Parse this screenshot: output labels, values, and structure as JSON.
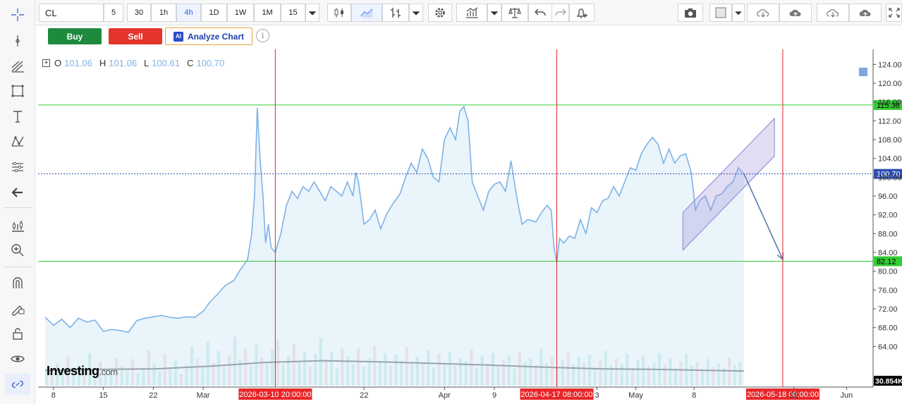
{
  "toolbar": {
    "symbol": "CL",
    "timeframes": [
      {
        "label": "5",
        "active": false
      },
      {
        "label": "30",
        "active": false
      },
      {
        "label": "1h",
        "active": false
      },
      {
        "label": "4h",
        "active": true
      },
      {
        "label": "1D",
        "active": false
      },
      {
        "label": "1W",
        "active": false
      },
      {
        "label": "1M",
        "active": false
      },
      {
        "label": "15",
        "active": false
      }
    ],
    "icons": [
      "candles-icon",
      "line-chart-icon",
      "bars-icon",
      "dropdown-icon",
      "settings-icon",
      "indicators-icon",
      "dropdown-icon",
      "compare-icon",
      "undo-icon",
      "redo-icon",
      "add-alert-icon",
      "camera-icon",
      "color-swatch-icon",
      "dropdown-icon",
      "cloud-download-icon",
      "cloud-upload-icon",
      "cloud-download-icon",
      "cloud-upload-icon",
      "fullscreen-icon"
    ]
  },
  "trade": {
    "buy_label": "Buy",
    "sell_label": "Sell",
    "analyze_label": "Analyze Chart",
    "ai_badge": "AI",
    "info_glyph": "i"
  },
  "legend": {
    "toggle_glyph": "+",
    "o_label": "O",
    "o_value": "101.06",
    "h_label": "H",
    "h_value": "101.06",
    "l_label": "L",
    "l_value": "100.61",
    "c_label": "C",
    "c_value": "100.70"
  },
  "logo": {
    "main": "Investing",
    "suffix": ".com"
  },
  "colors": {
    "line": "#7fb2e5",
    "area": "#e2f0fa",
    "hline": "#33cc33",
    "vline": "#e8262a",
    "current_price": "#2b4fb0",
    "vol_up": "#7fd6c0",
    "vol_down": "#f0a6b0",
    "channel": "#9a8fd6"
  },
  "chart_data": {
    "type": "area",
    "symbol": "CL",
    "interval": "4h",
    "ylim": [
      60,
      126
    ],
    "y_ticks": [
      "124.00",
      "120.00",
      "116.00",
      "112.00",
      "108.00",
      "104.00",
      "100.00",
      "96.00",
      "92.00",
      "88.00",
      "84.00",
      "80.00",
      "76.00",
      "72.00",
      "68.00",
      "64.00"
    ],
    "y_tick_values": [
      124,
      120,
      116,
      112,
      108,
      104,
      100,
      96,
      92,
      88,
      84,
      80,
      76,
      72,
      68,
      64
    ],
    "x_ticks": [
      {
        "label": "8",
        "idx": 0.3
      },
      {
        "label": "15",
        "idx": 2.1
      },
      {
        "label": "22",
        "idx": 3.9
      },
      {
        "label": "Mar",
        "idx": 5.7
      },
      {
        "label": "22",
        "idx": 11.5
      },
      {
        "label": "Apr",
        "idx": 14.4
      },
      {
        "label": "9",
        "idx": 16.2
      },
      {
        "label": "3",
        "idx": 19.9
      },
      {
        "label": "May",
        "idx": 21.3
      },
      {
        "label": "8",
        "idx": 23.4
      },
      {
        "label": "22",
        "idx": 27.0
      },
      {
        "label": "Jun",
        "idx": 28.9
      }
    ],
    "x_range": [
      0,
      29.5
    ],
    "price_series": [
      [
        0,
        70.2
      ],
      [
        0.3,
        68.5
      ],
      [
        0.6,
        69.8
      ],
      [
        0.9,
        68.0
      ],
      [
        1.2,
        70.0
      ],
      [
        1.5,
        69.2
      ],
      [
        1.8,
        69.6
      ],
      [
        2.1,
        67.2
      ],
      [
        2.4,
        67.6
      ],
      [
        2.7,
        67.4
      ],
      [
        3.0,
        67.0
      ],
      [
        3.3,
        69.5
      ],
      [
        3.6,
        70.0
      ],
      [
        3.9,
        70.3
      ],
      [
        4.2,
        70.6
      ],
      [
        4.5,
        70.2
      ],
      [
        4.8,
        70.0
      ],
      [
        5.1,
        70.3
      ],
      [
        5.4,
        70.2
      ],
      [
        5.7,
        71.5
      ],
      [
        5.95,
        73.5
      ],
      [
        6.2,
        75.0
      ],
      [
        6.5,
        77.0
      ],
      [
        6.8,
        78.0
      ],
      [
        7.0,
        80.0
      ],
      [
        7.3,
        82.5
      ],
      [
        7.45,
        88.0
      ],
      [
        7.55,
        96.0
      ],
      [
        7.65,
        114.8
      ],
      [
        7.75,
        104.0
      ],
      [
        7.85,
        96.5
      ],
      [
        7.95,
        86.0
      ],
      [
        8.05,
        90.0
      ],
      [
        8.15,
        85.0
      ],
      [
        8.3,
        84.0
      ],
      [
        8.5,
        88.0
      ],
      [
        8.7,
        94.0
      ],
      [
        8.9,
        97.0
      ],
      [
        9.1,
        95.5
      ],
      [
        9.3,
        98.0
      ],
      [
        9.5,
        97.0
      ],
      [
        9.7,
        99.0
      ],
      [
        9.9,
        97.0
      ],
      [
        10.1,
        95.0
      ],
      [
        10.3,
        98.0
      ],
      [
        10.5,
        97.0
      ],
      [
        10.7,
        96.0
      ],
      [
        10.9,
        99.0
      ],
      [
        11.1,
        96.0
      ],
      [
        11.2,
        101.0
      ],
      [
        11.3,
        99.0
      ],
      [
        11.5,
        90.0
      ],
      [
        11.7,
        91.0
      ],
      [
        11.9,
        93.0
      ],
      [
        12.1,
        89.0
      ],
      [
        12.3,
        92.0
      ],
      [
        12.5,
        94.0
      ],
      [
        12.8,
        96.5
      ],
      [
        13.0,
        100.0
      ],
      [
        13.2,
        103.0
      ],
      [
        13.4,
        101.0
      ],
      [
        13.6,
        106.0
      ],
      [
        13.8,
        104.0
      ],
      [
        14.0,
        100.0
      ],
      [
        14.2,
        99.0
      ],
      [
        14.4,
        108.0
      ],
      [
        14.6,
        110.5
      ],
      [
        14.8,
        108.0
      ],
      [
        14.95,
        114.0
      ],
      [
        15.1,
        115.0
      ],
      [
        15.25,
        112.0
      ],
      [
        15.4,
        99.0
      ],
      [
        15.6,
        96.0
      ],
      [
        15.8,
        93.0
      ],
      [
        16.0,
        97.0
      ],
      [
        16.2,
        98.5
      ],
      [
        16.4,
        99.0
      ],
      [
        16.6,
        97.0
      ],
      [
        16.8,
        103.5
      ],
      [
        17.0,
        96.0
      ],
      [
        17.2,
        90.0
      ],
      [
        17.4,
        91.0
      ],
      [
        17.7,
        90.5
      ],
      [
        17.9,
        92.5
      ],
      [
        18.1,
        94.0
      ],
      [
        18.25,
        93.0
      ],
      [
        18.35,
        85.0
      ],
      [
        18.45,
        81.8
      ],
      [
        18.55,
        87.0
      ],
      [
        18.7,
        86.0
      ],
      [
        18.9,
        87.5
      ],
      [
        19.1,
        87.0
      ],
      [
        19.3,
        91.0
      ],
      [
        19.5,
        88.0
      ],
      [
        19.7,
        93.5
      ],
      [
        19.9,
        92.5
      ],
      [
        20.1,
        95.0
      ],
      [
        20.3,
        95.5
      ],
      [
        20.5,
        98.0
      ],
      [
        20.7,
        96.0
      ],
      [
        20.9,
        99.0
      ],
      [
        21.1,
        102.0
      ],
      [
        21.3,
        101.5
      ],
      [
        21.5,
        105.0
      ],
      [
        21.7,
        107.0
      ],
      [
        21.9,
        108.5
      ],
      [
        22.1,
        107.0
      ],
      [
        22.3,
        103.0
      ],
      [
        22.5,
        106.0
      ],
      [
        22.7,
        103.0
      ],
      [
        22.9,
        104.5
      ],
      [
        23.1,
        105.0
      ],
      [
        23.3,
        101.0
      ],
      [
        23.45,
        93.0
      ],
      [
        23.6,
        95.0
      ],
      [
        23.8,
        96.0
      ],
      [
        24.0,
        93.0
      ],
      [
        24.2,
        96.0
      ],
      [
        24.4,
        96.5
      ],
      [
        24.6,
        98.0
      ],
      [
        24.8,
        99.0
      ],
      [
        25.0,
        102.0
      ],
      [
        25.2,
        100.7
      ]
    ],
    "volume_series": [
      3.2,
      1.8,
      4.1,
      2.6,
      5.5,
      2.0,
      3.8,
      2.9,
      6.0,
      1.5,
      4.4,
      3.1,
      2.2,
      5.1,
      3.6,
      2.8,
      4.9,
      2.4,
      3.3,
      6.5,
      4.0,
      2.7,
      5.8,
      3.0,
      4.6,
      2.1,
      3.9,
      7.2,
      5.0,
      3.4,
      8.1,
      4.2,
      6.4,
      3.5,
      5.6,
      9.0,
      4.8,
      6.9,
      3.7,
      7.5,
      5.2,
      4.1,
      6.6,
      8.4,
      3.9,
      5.5,
      7.8,
      4.4,
      6.1,
      3.6,
      5.9,
      8.8,
      4.7,
      6.3,
      3.2,
      7.0,
      5.4,
      4.0,
      6.8,
      3.5,
      5.0,
      7.4,
      4.3,
      6.0,
      3.8,
      5.7,
      4.6,
      7.1,
      3.9,
      5.3,
      4.2,
      6.5,
      3.4,
      5.8,
      4.0,
      6.2,
      3.7,
      5.1,
      4.5,
      6.7,
      3.3,
      5.5,
      4.1,
      6.0,
      3.6,
      4.9,
      5.6,
      3.2,
      6.3,
      4.4,
      5.0,
      3.8,
      6.9,
      4.2,
      5.4,
      3.5,
      4.8,
      6.1,
      3.9,
      5.2,
      4.3,
      5.7,
      3.4,
      4.6,
      6.4,
      3.7,
      5.0,
      4.0,
      5.9,
      3.3,
      4.7,
      5.5,
      3.6,
      4.2,
      6.0,
      3.9,
      5.1,
      3.2,
      4.5,
      5.8,
      3.7,
      4.3,
      3.0,
      4.9,
      3.5,
      4.1,
      3.3,
      5.2,
      3.8,
      4.4
    ],
    "volume_ylim": [
      0,
      10
    ],
    "volume_avg_series": [
      [
        0,
        2.8
      ],
      [
        2,
        3.0
      ],
      [
        4,
        3.1
      ],
      [
        6,
        3.6
      ],
      [
        8,
        4.3
      ],
      [
        10,
        4.6
      ],
      [
        12,
        4.4
      ],
      [
        14,
        4.1
      ],
      [
        16,
        3.8
      ],
      [
        18,
        3.4
      ],
      [
        20,
        3.1
      ],
      [
        22,
        3.0
      ],
      [
        24,
        2.8
      ],
      [
        25.2,
        2.7
      ]
    ],
    "horizontal_lines": [
      {
        "value": 115.36,
        "label": "115.36"
      },
      {
        "value": 82.12,
        "label": "82.12"
      }
    ],
    "current_price": {
      "value": 100.7,
      "label": "100.70"
    },
    "vertical_lines": [
      {
        "idx": 8.3,
        "label": "2026-03-10 20:00:00"
      },
      {
        "idx": 18.45,
        "label": "2026-04-17 08:00:00"
      },
      {
        "idx": 26.6,
        "label": "2026-05-18 00:00:00"
      }
    ],
    "volume_axis_label": "30.854K",
    "channel": {
      "start": [
        23.0,
        84.5
      ],
      "end": [
        26.3,
        104.5
      ],
      "width": 8.0
    },
    "arrow": {
      "from": [
        25.2,
        100.7
      ],
      "to": [
        26.6,
        82.5
      ]
    }
  }
}
